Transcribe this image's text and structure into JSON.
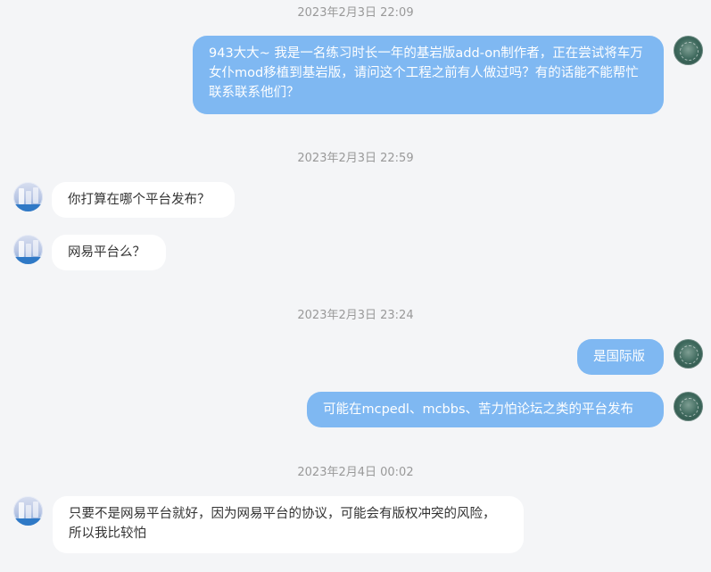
{
  "timestamps": [
    "2023年2月3日 22:09",
    "2023年2月3日 22:59",
    "2023年2月3日 23:24",
    "2023年2月4日 00:02"
  ],
  "messages": [
    {
      "sender": "me",
      "text": "943大大~ 我是一名练习时长一年的基岩版add-on制作者，正在尝试将车万女仆mod移植到基岩版，请问这个工程之前有人做过吗？有的话能不能帮忙联系联系他们？"
    },
    {
      "sender": "other",
      "text": "你打算在哪个平台发布？"
    },
    {
      "sender": "other",
      "text": "网易平台么？"
    },
    {
      "sender": "me",
      "text": "是国际版"
    },
    {
      "sender": "me",
      "text": "可能在mcpedl、mcbbs、苦力怕论坛之类的平台发布"
    },
    {
      "sender": "other",
      "text": "只要不是网易平台就好，因为网易平台的协议，可能会有版权冲突的风险，所以我比较怕"
    }
  ],
  "colors": {
    "background": "#f4f5f7",
    "my_bubble": "#7fb8f2",
    "other_bubble": "#ffffff",
    "timestamp": "#999999"
  }
}
